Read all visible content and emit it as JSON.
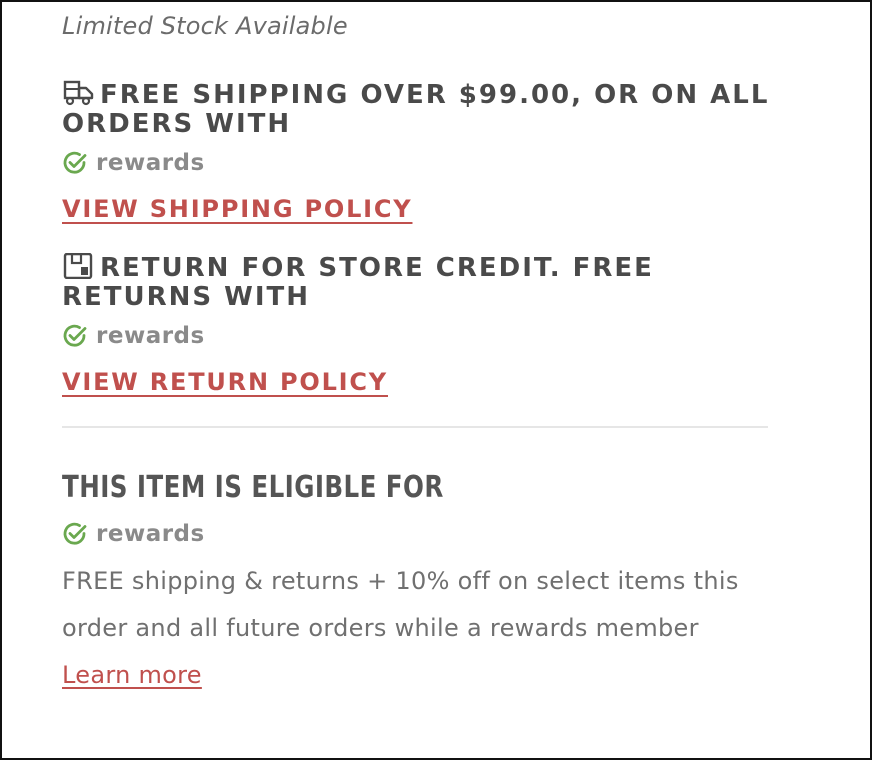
{
  "stock_status": "Limited Stock Available",
  "shipping": {
    "heading": "FREE SHIPPING OVER $99.00, OR ON ALL ORDERS WITH",
    "icon": "truck-icon",
    "rewards_label": "rewards",
    "link_label": "VIEW SHIPPING POLICY"
  },
  "returns": {
    "heading": "RETURN FOR STORE CREDIT. FREE RETURNS WITH",
    "icon": "return-box-icon",
    "rewards_label": "rewards",
    "link_label": "VIEW RETURN POLICY"
  },
  "eligibility": {
    "title": "THIS ITEM IS ELIGIBLE FOR",
    "rewards_label": "rewards",
    "description": "FREE shipping & returns + 10% off on select items this order and all future orders while a rewards member",
    "learn_more_label": "Learn more"
  },
  "colors": {
    "accent_red": "#c0504d",
    "check_green": "#6aa84f",
    "heading_gray": "#4a4a4a"
  }
}
